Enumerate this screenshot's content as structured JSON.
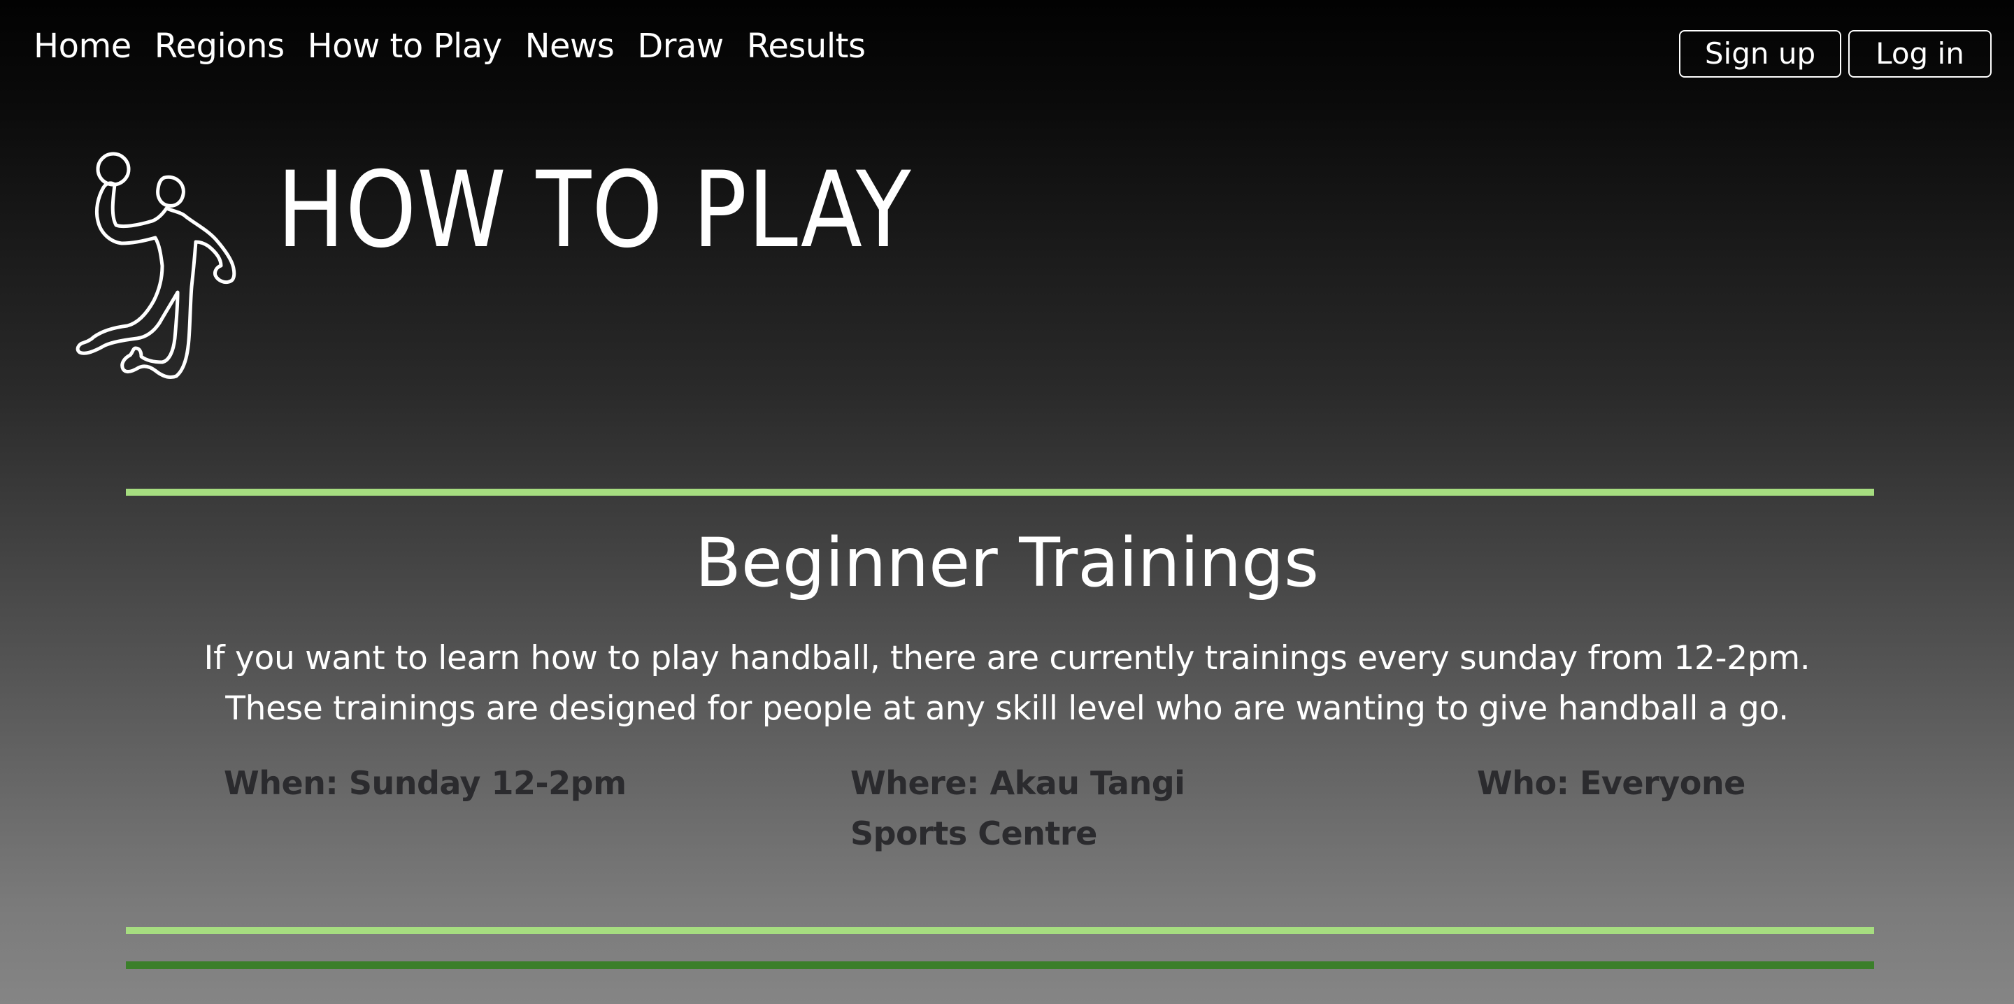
{
  "nav": {
    "links": [
      {
        "label": "Home"
      },
      {
        "label": "Regions"
      },
      {
        "label": "How to Play"
      },
      {
        "label": "News"
      },
      {
        "label": "Draw"
      },
      {
        "label": "Results"
      }
    ],
    "signup_label": "Sign up",
    "login_label": "Log in"
  },
  "hero": {
    "icon": "handball-player-icon",
    "title": "HOW TO PLAY"
  },
  "section": {
    "title": "Beginner Trainings",
    "text": "If you want to learn how to play handball, there are currently trainings every sunday from 12-2pm. These trainings are designed for people at any skill level who are wanting to give handball a go.",
    "when": "When: Sunday 12-2pm",
    "where": "Where: Akau Tangi Sports Centre",
    "who": "Who: Everyone"
  },
  "colors": {
    "accent_light_green": "#a6dd80",
    "accent_dark_green": "#3b7f2a",
    "info_text": "#2b2b2e"
  }
}
